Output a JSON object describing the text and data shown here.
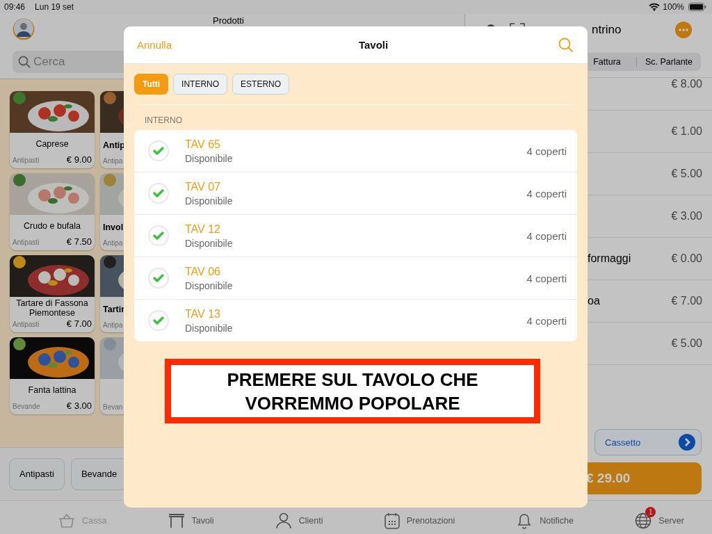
{
  "status_bar": {
    "time": "09:46",
    "date": "Lun 19 set",
    "battery": "100%"
  },
  "products_panel": {
    "title": "Prodotti",
    "search": {
      "placeholder": "Cerca"
    },
    "products": [
      {
        "name": "Caprese",
        "category": "Antipasti",
        "price": "€ 9.00"
      },
      {
        "name": "Antip",
        "category": "Antipa"
      },
      {
        "name": "Crudo e bufala",
        "category": "Antipasti",
        "price": "€ 7.50"
      },
      {
        "name": "Invol",
        "category": "Antipa"
      },
      {
        "name": "Tartare di Fassona Piemontese",
        "category": "Antipasti",
        "price": "€ 7.00"
      },
      {
        "name": "Tartir",
        "category": "Antipa"
      },
      {
        "name": "Fanta lattina",
        "category": "Bevande",
        "price": "€ 3.00"
      },
      {
        "category": "Bevan"
      }
    ],
    "categories": [
      "Antipasti",
      "Bevande"
    ]
  },
  "receipt_panel": {
    "title": "ntrino",
    "segments": [
      "Fattura",
      "Sc. Parlante"
    ],
    "rows": [
      {
        "amount": "€ 8.00"
      },
      {
        "amount": "€ 1.00"
      },
      {
        "amount": "€ 5.00"
      },
      {
        "amount": "€ 3.00"
      },
      {
        "name": "formaggi",
        "amount": "€ 0.00"
      },
      {
        "name": "oa",
        "amount": "€ 7.00"
      },
      {
        "amount": "€ 5.00"
      }
    ],
    "drawer_button": "Cassetto",
    "total": "€ 29.00"
  },
  "modal": {
    "cancel": "Annulla",
    "title": "Tavoli",
    "filters": [
      {
        "label": "Tutti",
        "selected": true
      },
      {
        "label": "INTERNO",
        "selected": false
      },
      {
        "label": "ESTERNO",
        "selected": false
      }
    ],
    "section": "INTERNO",
    "tables": [
      {
        "name": "TAV 65",
        "status": "Disponibile",
        "available": true,
        "seats": "4 coperti"
      },
      {
        "name": "TAV 07",
        "status": "Disponibile",
        "available": true,
        "seats": "4 coperti"
      },
      {
        "name": "TAV 12",
        "status": "Disponibile",
        "available": true,
        "seats": "4 coperti"
      },
      {
        "name": "TAV 06",
        "status": "Disponibile",
        "available": true,
        "seats": "4 coperti"
      },
      {
        "name": "TAV 13",
        "status": "Disponibile",
        "available": true,
        "seats": "4 coperti"
      }
    ],
    "annotation": "PREMERE SUL TAVOLO CHE VORREMMO POPOLARE"
  },
  "tab_bar": [
    {
      "label": "Cassa",
      "kind": "basket",
      "disabled": true
    },
    {
      "label": "Tavoli",
      "kind": "table",
      "disabled": false
    },
    {
      "label": "Clienti",
      "kind": "person",
      "disabled": false
    },
    {
      "label": "Prenotazioni",
      "kind": "calendar",
      "disabled": false
    },
    {
      "label": "Notifiche",
      "kind": "bell",
      "disabled": false
    },
    {
      "label": "Server",
      "kind": "globe",
      "disabled": false,
      "badge": "1"
    }
  ]
}
